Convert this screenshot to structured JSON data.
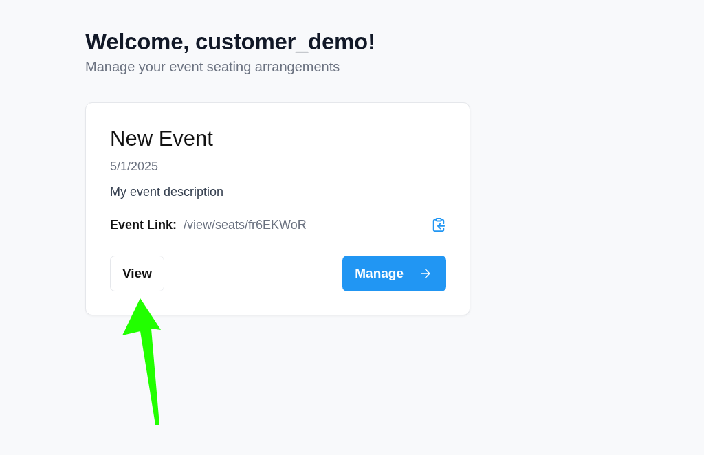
{
  "header": {
    "title": "Welcome, customer_demo!",
    "subtitle": "Manage your event seating arrangements"
  },
  "events": [
    {
      "title": "New Event",
      "date": "5/1/2025",
      "description": "My event description",
      "link_label": "Event Link:",
      "link": "/view/seats/fr6EKWoR",
      "buttons": [
        {
          "label": "View",
          "kind": "outline"
        },
        {
          "label": "Manage",
          "kind": "primary"
        }
      ]
    }
  ]
}
